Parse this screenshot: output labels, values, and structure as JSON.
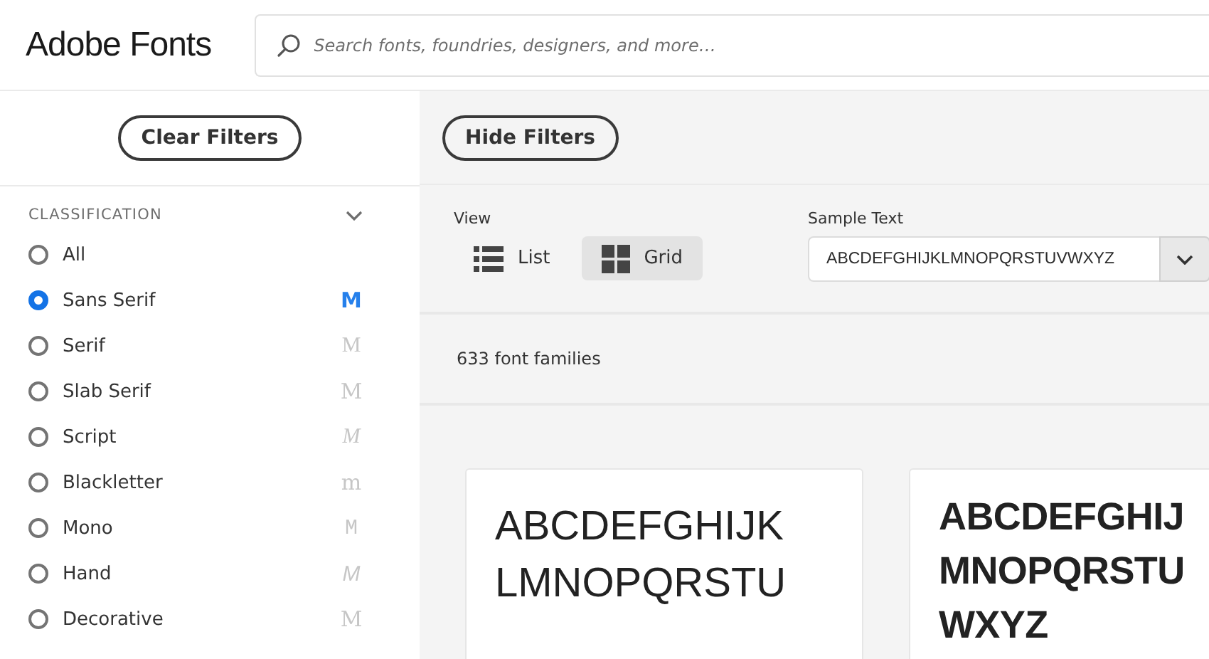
{
  "header": {
    "logo": "Adobe Fonts",
    "search": {
      "placeholder": "Search fonts, foundries, designers, and more…"
    }
  },
  "sidebar": {
    "button": "Clear Filters",
    "section": {
      "title": "CLASSIFICATION",
      "expanded": true,
      "items": [
        {
          "label": "All",
          "selected": false
        },
        {
          "label": "Sans Serif",
          "selected": true,
          "kind": "sans",
          "sample": "M"
        },
        {
          "label": "Serif",
          "selected": false,
          "kind": "serif",
          "sample": "M"
        },
        {
          "label": "Slab Serif",
          "selected": false,
          "kind": "slab",
          "sample": "M"
        },
        {
          "label": "Script",
          "selected": false,
          "kind": "script",
          "sample": "M"
        },
        {
          "label": "Blackletter",
          "selected": false,
          "kind": "blackletter",
          "sample": "m"
        },
        {
          "label": "Mono",
          "selected": false,
          "kind": "mono",
          "sample": "M"
        },
        {
          "label": "Hand",
          "selected": false,
          "kind": "hand",
          "sample": "M"
        },
        {
          "label": "Decorative",
          "selected": false,
          "kind": "decorative",
          "sample": "M"
        }
      ]
    }
  },
  "main": {
    "button": "Hide Filters",
    "view": {
      "label": "View",
      "options": [
        {
          "label": "List",
          "kind": "list",
          "selected": false
        },
        {
          "label": "Grid",
          "kind": "grid",
          "selected": true
        }
      ]
    },
    "sample_text": {
      "label": "Sample Text",
      "value": "ABCDEFGHIJKLMNOPQRSTUVWXYZ"
    },
    "count": "633 font families",
    "cards": [
      {
        "lines": [
          "ABCDEFGHIJK",
          "LMNOPQRSTU"
        ]
      },
      {
        "lines": [
          "ABCDEFGHIJ",
          "MNOPQRSTU",
          "WXYZ"
        ]
      }
    ]
  }
}
